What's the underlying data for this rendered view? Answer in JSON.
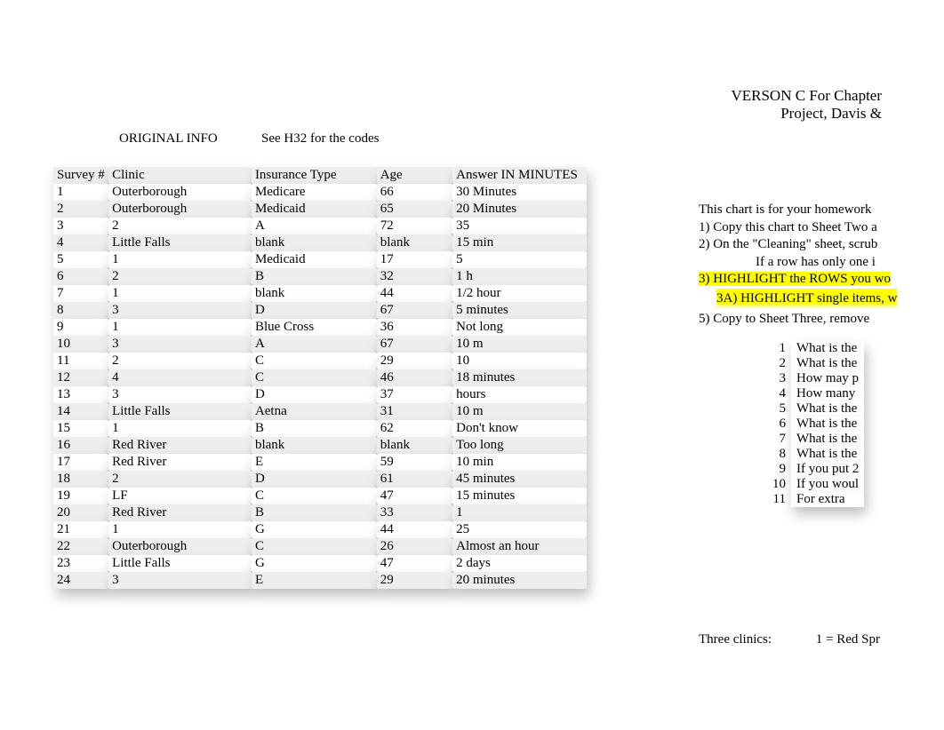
{
  "heading": {
    "line1": "VERSON C For Chapter",
    "line2": "Project, Davis &"
  },
  "labels": {
    "original_info": "ORIGINAL INFO",
    "see_codes": "See H32 for the codes"
  },
  "table": {
    "headers": {
      "survey": "Survey #",
      "clinic": "Clinic",
      "insurance": "Insurance Type",
      "age": "Age",
      "answer": "Answer IN MINUTES"
    },
    "rows": [
      {
        "survey": "1",
        "clinic": "Outerborough",
        "ins": "Medicare",
        "age": "66",
        "ans": "30 Minutes"
      },
      {
        "survey": "2",
        "clinic": "Outerborough",
        "ins": "Medicaid",
        "age": "65",
        "ans": "20 Minutes"
      },
      {
        "survey": "3",
        "clinic": "2",
        "ins": "A",
        "age": "72",
        "ans": "35"
      },
      {
        "survey": "4",
        "clinic": "Little Falls",
        "ins": "blank",
        "age": "blank",
        "ans": "15 min"
      },
      {
        "survey": "5",
        "clinic": "1",
        "ins": "Medicaid",
        "age": "17",
        "ans": "5"
      },
      {
        "survey": "6",
        "clinic": "2",
        "ins": "B",
        "age": "32",
        "ans": "1 h"
      },
      {
        "survey": "7",
        "clinic": "1",
        "ins": "blank",
        "age": "44",
        "ans": "1/2 hour"
      },
      {
        "survey": "8",
        "clinic": "3",
        "ins": "D",
        "age": "67",
        "ans": "5 minutes"
      },
      {
        "survey": "9",
        "clinic": "1",
        "ins": "Blue Cross",
        "age": "36",
        "ans": "Not long"
      },
      {
        "survey": "10",
        "clinic": "3",
        "ins": "A",
        "age": "67",
        "ans": "10 m"
      },
      {
        "survey": "11",
        "clinic": "2",
        "ins": "C",
        "age": "29",
        "ans": "10"
      },
      {
        "survey": "12",
        "clinic": "4",
        "ins": "C",
        "age": "46",
        "ans": "18 minutes"
      },
      {
        "survey": "13",
        "clinic": "3",
        "ins": "D",
        "age": "37",
        "ans": "hours"
      },
      {
        "survey": "14",
        "clinic": "Little Falls",
        "ins": "Aetna",
        "age": "31",
        "ans": "10 m"
      },
      {
        "survey": "15",
        "clinic": "1",
        "ins": "B",
        "age": "62",
        "ans": "Don't know"
      },
      {
        "survey": "16",
        "clinic": "Red River",
        "ins": "blank",
        "age": "blank",
        "ans": "Too long"
      },
      {
        "survey": "17",
        "clinic": "Red River",
        "ins": "E",
        "age": "59",
        "ans": "10 min"
      },
      {
        "survey": "18",
        "clinic": "2",
        "ins": "D",
        "age": "61",
        "ans": "45 minutes"
      },
      {
        "survey": "19",
        "clinic": "LF",
        "ins": "C",
        "age": "47",
        "ans": "15 minutes"
      },
      {
        "survey": "20",
        "clinic": "Red River",
        "ins": "B",
        "age": "33",
        "ans": "1"
      },
      {
        "survey": "21",
        "clinic": "1",
        "ins": "G",
        "age": "44",
        "ans": "25"
      },
      {
        "survey": "22",
        "clinic": "Outerborough",
        "ins": "C",
        "age": "26",
        "ans": "Almost an hour"
      },
      {
        "survey": "23",
        "clinic": "Little Falls",
        "ins": "G",
        "age": "47",
        "ans": "2 days"
      },
      {
        "survey": "24",
        "clinic": "3",
        "ins": "E",
        "age": "29",
        "ans": "20 minutes"
      }
    ]
  },
  "instructions": {
    "intro": "This chart is for your homework",
    "step1": "1) Copy this chart to Sheet Two a",
    "step2": "2) On the \"Cleaning\" sheet, scrub",
    "step2a": "If a row has only one i",
    "step3": "3) HIGHLIGHT the ROWS you wo",
    "step3a": "3A) HIGHLIGHT single items, w",
    "step5": "5) Copy to Sheet Three, remove"
  },
  "questions": [
    {
      "n": "1",
      "t": "What is the"
    },
    {
      "n": "2",
      "t": "What is the"
    },
    {
      "n": "3",
      "t": "How may p"
    },
    {
      "n": "4",
      "t": "How many"
    },
    {
      "n": "5",
      "t": "What is the"
    },
    {
      "n": "6",
      "t": "What is the"
    },
    {
      "n": "7",
      "t": "What is the"
    },
    {
      "n": "8",
      "t": "What is the"
    },
    {
      "n": "9",
      "t": "If you put 2"
    },
    {
      "n": "10",
      "t": "If you woul"
    },
    {
      "n": "11",
      "t": "For extra"
    }
  ],
  "three_clinics": {
    "label": "Three clinics:",
    "value": "1 = Red Spr"
  }
}
